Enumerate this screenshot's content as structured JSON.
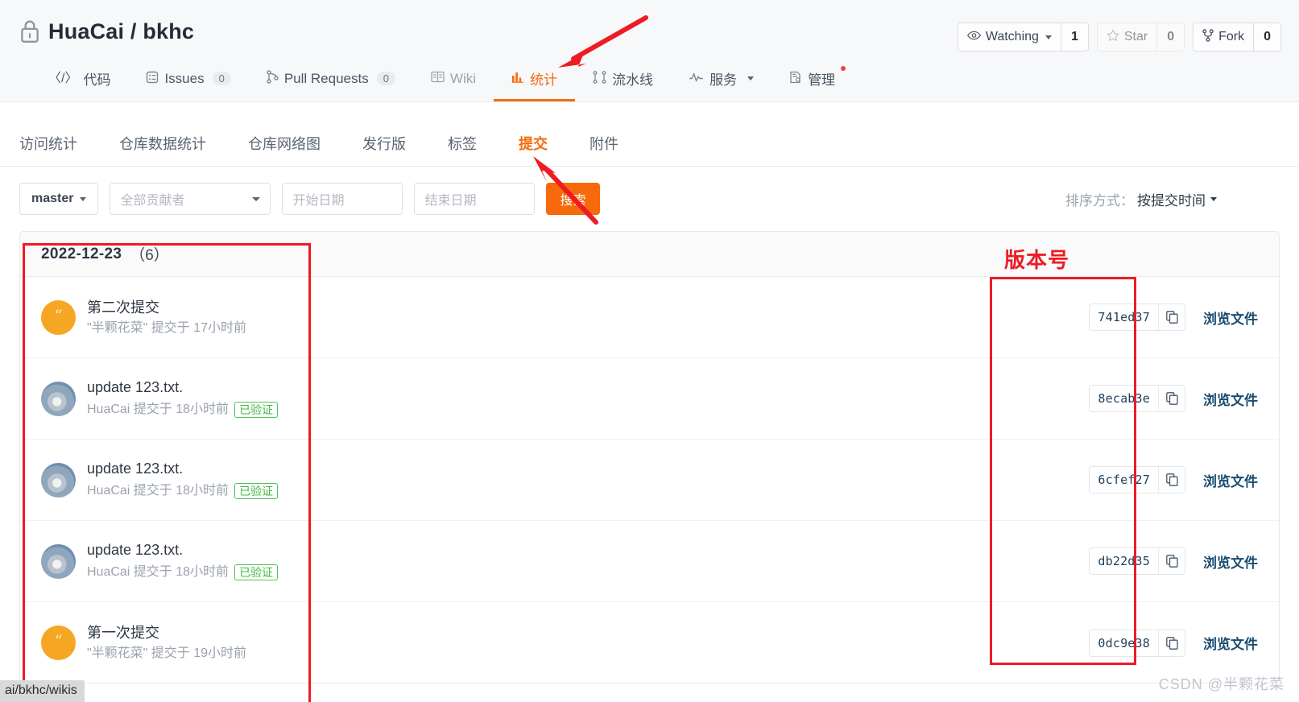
{
  "header": {
    "lock_icon": "lock-icon",
    "repo_owner": "HuaCai",
    "repo_separator": "/",
    "repo_name": "bkhc",
    "repo_full_title": "HuaCai / bkhc",
    "actions": [
      {
        "icon": "eye-icon",
        "label": "Watching",
        "has_caret": true,
        "count": "1",
        "muted": false
      },
      {
        "icon": "star-icon",
        "label": "Star",
        "has_caret": false,
        "count": "0",
        "muted": true
      },
      {
        "icon": "fork-icon",
        "label": "Fork",
        "has_caret": false,
        "count": "0",
        "muted": false
      }
    ]
  },
  "nav": {
    "items": [
      {
        "icon": "code-icon",
        "label": "代码",
        "badge": null,
        "active": false,
        "caret": false,
        "dot": false
      },
      {
        "icon": "issues-icon",
        "label": "Issues",
        "badge": "0",
        "active": false,
        "caret": false,
        "dot": false
      },
      {
        "icon": "pull-request-icon",
        "label": "Pull Requests",
        "badge": "0",
        "active": false,
        "caret": false,
        "dot": false
      },
      {
        "icon": "wiki-book-icon",
        "label": "Wiki",
        "badge": null,
        "active": false,
        "caret": false,
        "dot": false
      },
      {
        "icon": "chart-bar-icon",
        "label": "统计",
        "badge": null,
        "active": true,
        "caret": false,
        "dot": false
      },
      {
        "icon": "pipeline-icon",
        "label": "流水线",
        "badge": null,
        "active": false,
        "caret": false,
        "dot": false
      },
      {
        "icon": "pulse-icon",
        "label": "服务",
        "badge": null,
        "active": false,
        "caret": true,
        "dot": false
      },
      {
        "icon": "settings-doc-icon",
        "label": "管理",
        "badge": null,
        "active": false,
        "caret": false,
        "dot": true
      }
    ]
  },
  "sub_nav": {
    "items": [
      {
        "label": "访问统计",
        "active": false
      },
      {
        "label": "仓库数据统计",
        "active": false
      },
      {
        "label": "仓库网络图",
        "active": false
      },
      {
        "label": "发行版",
        "active": false
      },
      {
        "label": "标签",
        "active": false
      },
      {
        "label": "提交",
        "active": true
      },
      {
        "label": "附件",
        "active": false
      }
    ]
  },
  "filters": {
    "branch_value": "master",
    "contributor_placeholder": "全部贡献者",
    "start_date_placeholder": "开始日期",
    "end_date_placeholder": "结束日期",
    "search_button": "搜索",
    "sort_label": "排序方式：",
    "sort_value": "按提交时间"
  },
  "commits": {
    "group_date": "2022-12-23",
    "group_count": "（6）",
    "rows": [
      {
        "avatar": "avatar-orange-quote",
        "message": "第二次提交",
        "author_text": "\"半颗花菜\" 提交于 17小时前",
        "verified": null,
        "hash": "741ed37",
        "copy_icon": "copy-icon",
        "browse_label": "浏览文件"
      },
      {
        "avatar": "avatar-photo",
        "message": "update 123.txt.",
        "author_text": "HuaCai 提交于 18小时前",
        "verified": "已验证",
        "hash": "8ecab3e",
        "copy_icon": "copy-icon",
        "browse_label": "浏览文件"
      },
      {
        "avatar": "avatar-photo",
        "message": "update 123.txt.",
        "author_text": "HuaCai 提交于 18小时前",
        "verified": "已验证",
        "hash": "6cfef27",
        "copy_icon": "copy-icon",
        "browse_label": "浏览文件"
      },
      {
        "avatar": "avatar-photo",
        "message": "update 123.txt.",
        "author_text": "HuaCai 提交于 18小时前",
        "verified": "已验证",
        "hash": "db22d35",
        "copy_icon": "copy-icon",
        "browse_label": "浏览文件"
      },
      {
        "avatar": "avatar-orange-quote",
        "message": "第一次提交",
        "author_text": "\"半颗花菜\" 提交于 19小时前",
        "verified": null,
        "hash": "0dc9e38",
        "copy_icon": "copy-icon",
        "browse_label": "浏览文件"
      }
    ]
  },
  "annotations": {
    "version_label": "版本号",
    "accent_color": "#ee1b24",
    "arrow_color": "#ee1b24"
  },
  "status_bar": {
    "url_text": "ai/bkhc/wikis"
  },
  "watermark": {
    "text": "CSDN @半颗花菜"
  }
}
